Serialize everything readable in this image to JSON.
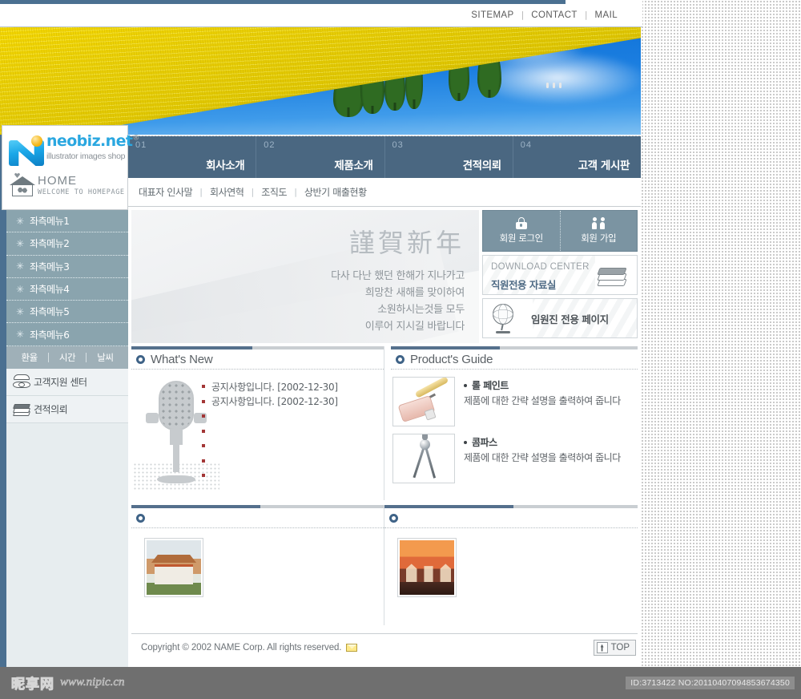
{
  "topbar": {
    "links": [
      {
        "label": "SITEMAP"
      },
      {
        "label": "CONTACT"
      },
      {
        "label": "MAIL"
      }
    ],
    "separator": "|"
  },
  "logo": {
    "name": "neobiz.net",
    "registered": "®",
    "tagline": "illustrator images shop",
    "home_title": "HOME",
    "home_sub": "WELCOME TO HOMEPAGE"
  },
  "mainnav": [
    {
      "num": "01",
      "label": "회사소개"
    },
    {
      "num": "02",
      "label": "제품소개"
    },
    {
      "num": "03",
      "label": "견적의뢰"
    },
    {
      "num": "04",
      "label": "고객 게시판"
    }
  ],
  "subnav": {
    "items": [
      {
        "label": "대표자 인사말"
      },
      {
        "label": "회사연혁"
      },
      {
        "label": "조직도"
      },
      {
        "label": "상반기 매출현황"
      }
    ],
    "separator": "|"
  },
  "sidebar": {
    "menu": [
      {
        "label": "좌측메뉴1"
      },
      {
        "label": "좌측메뉴2"
      },
      {
        "label": "좌측메뉴3"
      },
      {
        "label": "좌측메뉴4"
      },
      {
        "label": "좌측메뉴5"
      },
      {
        "label": "좌측메뉴6"
      }
    ],
    "tabs": [
      {
        "label": "환율"
      },
      {
        "label": "시간"
      },
      {
        "label": "날씨"
      }
    ],
    "links": [
      {
        "label": "고객지원 센터",
        "icon": "phone-icon"
      },
      {
        "label": "견적의뢰",
        "icon": "books-icon"
      }
    ]
  },
  "welcome": {
    "hanja": "謹賀新年",
    "lines": [
      "다사 다난 했던 한해가 지나가고",
      "희망찬 새해를 맞이하여",
      "소원하시는것들 모두",
      "이루어 지시길 바랍니다"
    ]
  },
  "widgets": {
    "login": {
      "label": "회원 로그인",
      "icon": "lock-icon"
    },
    "join": {
      "label": "회원 가입",
      "icon": "people-icon"
    },
    "download": {
      "title": "DOWNLOAD CENTER",
      "subtitle": "직원전용 자료실",
      "icon": "books-icon"
    },
    "executive": {
      "label": "임원진 전용 페이지",
      "icon": "globe-icon"
    }
  },
  "whats_new": {
    "title": "What's New",
    "items": [
      {
        "text": "공지사항입니다. [2002-12-30]"
      },
      {
        "text": "공지사항입니다. [2002-12-30]"
      },
      {
        "text": ""
      },
      {
        "text": ""
      },
      {
        "text": ""
      },
      {
        "text": ""
      },
      {
        "text": ""
      }
    ]
  },
  "products": {
    "title": "Product's Guide",
    "items": [
      {
        "name": "롤 페인트",
        "desc": "제품에 대한 간략 설명을 출력하여 줍니다",
        "thumb": "paint-roller-image"
      },
      {
        "name": "콤파스",
        "desc": "제품에 대한 간략 설명을 출력하여 줍니다",
        "thumb": "compass-image"
      }
    ]
  },
  "gallery": [
    {
      "title": "",
      "thumb": "temple-photo"
    },
    {
      "title": "",
      "thumb": "palace-photo"
    }
  ],
  "footer": {
    "copyright": "Copyright © 2002 NAME Corp. All rights reserved.",
    "mail_icon": "mail-icon",
    "top_label": "TOP"
  },
  "watermark": {
    "cn_name": "昵享网",
    "url": "www.nipic.cn",
    "id_text": "ID:3713422 NO:20110407094853674350"
  },
  "colors": {
    "nav_blue": "#4a6781",
    "spine_blue": "#4b7091",
    "sidebar_teal": "#8aa4ae",
    "accent_ring": "#3f6387",
    "sky_blue": "#1878d8",
    "field_yellow": "#f5d800"
  }
}
